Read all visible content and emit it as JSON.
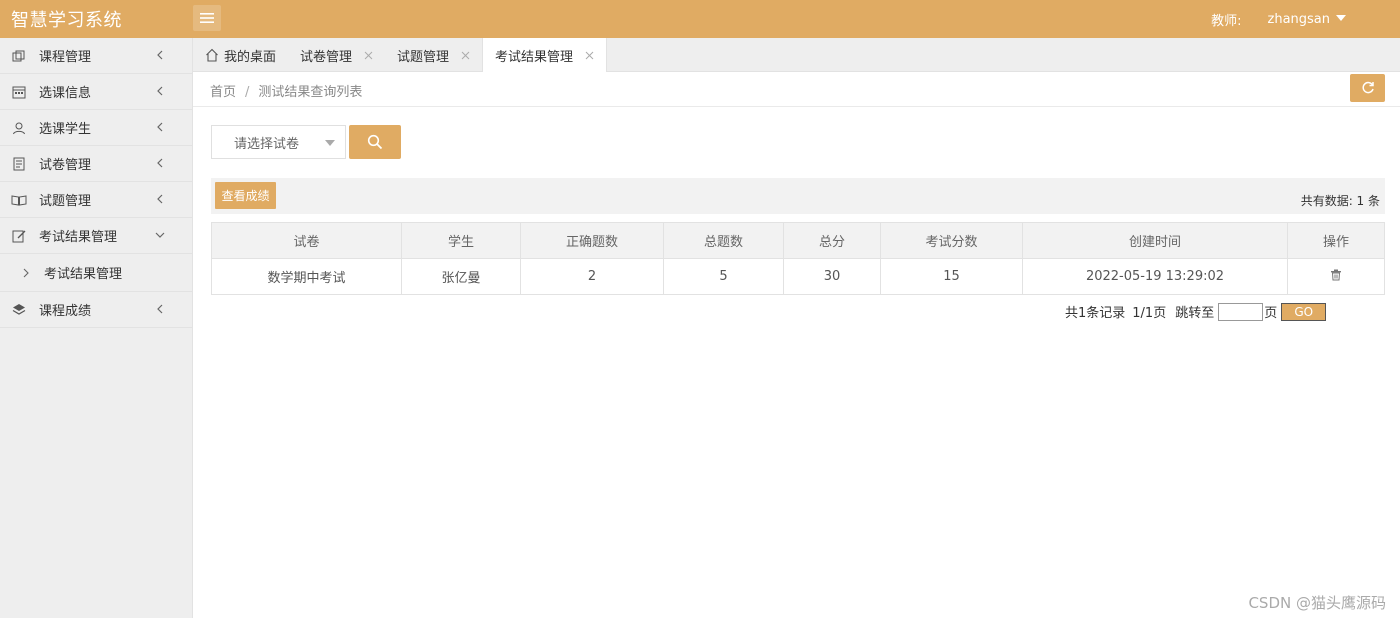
{
  "header": {
    "app_title": "智慧学习系统",
    "role_label": "教师:",
    "username": "zhangsan"
  },
  "sidebar": {
    "items": [
      {
        "label": "课程管理"
      },
      {
        "label": "选课信息"
      },
      {
        "label": "选课学生"
      },
      {
        "label": "试卷管理"
      },
      {
        "label": "试题管理"
      },
      {
        "label": "考试结果管理"
      }
    ],
    "sub_item": "考试结果管理",
    "last_item": "课程成绩"
  },
  "tabs": [
    {
      "label": "我的桌面"
    },
    {
      "label": "试卷管理"
    },
    {
      "label": "试题管理"
    },
    {
      "label": "考试结果管理"
    }
  ],
  "breadcrumb": {
    "home": "首页",
    "separator": "/",
    "current": "测试结果查询列表"
  },
  "search": {
    "select_placeholder": "请选择试卷"
  },
  "toolbar": {
    "view_button": "查看成绩",
    "total_text": "共有数据: 1 条"
  },
  "table": {
    "headers": [
      "试卷",
      "学生",
      "正确题数",
      "总题数",
      "总分",
      "考试分数",
      "创建时间",
      "操作"
    ],
    "rows": [
      [
        "数学期中考试",
        "张亿曼",
        "2",
        "5",
        "30",
        "15",
        "2022-05-19 13:29:02"
      ]
    ]
  },
  "pager": {
    "summary": "共1条记录",
    "page_info": "1/1页",
    "jump_label": "跳转至",
    "page_suffix": "页",
    "go_label": "GO"
  },
  "watermark": "CSDN @猫头鹰源码",
  "colors": {
    "accent": "#e0ab63",
    "sidebar_bg": "#eeeeee"
  }
}
